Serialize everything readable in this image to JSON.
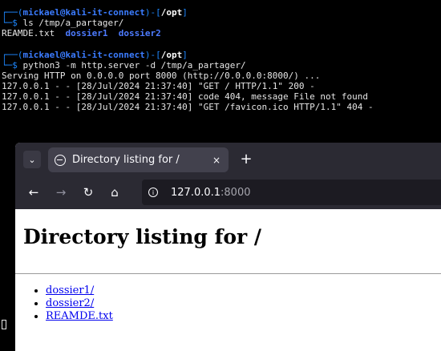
{
  "terminal": {
    "prompt1": {
      "corner_top": "┌──(",
      "user": "mickael",
      "at": "@",
      "host": "kali-it-connect",
      "close": ")-[",
      "path": "/opt",
      "end": "]"
    },
    "cmd1_prefix": "└─$ ",
    "cmd1": "ls /tmp/a_partager/",
    "ls_file": "REAMDE.txt",
    "ls_dir1": "dossier1",
    "ls_dir2": "dossier2",
    "prompt2": {
      "corner_top": "┌──(",
      "user": "mickael",
      "at": "@",
      "host": "kali-it-connect",
      "close": ")-[",
      "path": "/opt",
      "end": "]"
    },
    "cmd2_prefix": "└─$ ",
    "cmd2": "python3 -m http.server -d /tmp/a_partager/",
    "out1": "Serving HTTP on 0.0.0.0 port 8000 (http://0.0.0.0:8000/) ...",
    "out2": "127.0.0.1 - - [28/Jul/2024 21:37:40] \"GET / HTTP/1.1\" 200 -",
    "out3": "127.0.0.1 - - [28/Jul/2024 21:37:40] code 404, message File not found",
    "out4": "127.0.0.1 - - [28/Jul/2024 21:37:40] \"GET /favicon.ico HTTP/1.1\" 404 -"
  },
  "browser": {
    "tab_dropdown": "⌄",
    "tab_title": "Directory listing for /",
    "tab_close": "×",
    "new_tab": "+",
    "back": "←",
    "forward": "→",
    "reload": "↻",
    "home": "⌂",
    "url_host": "127.0.0.1",
    "url_port": ":8000",
    "page": {
      "heading": "Directory listing for /",
      "links": [
        "dossier1/",
        "dossier2/",
        "REAMDE.txt"
      ]
    }
  }
}
